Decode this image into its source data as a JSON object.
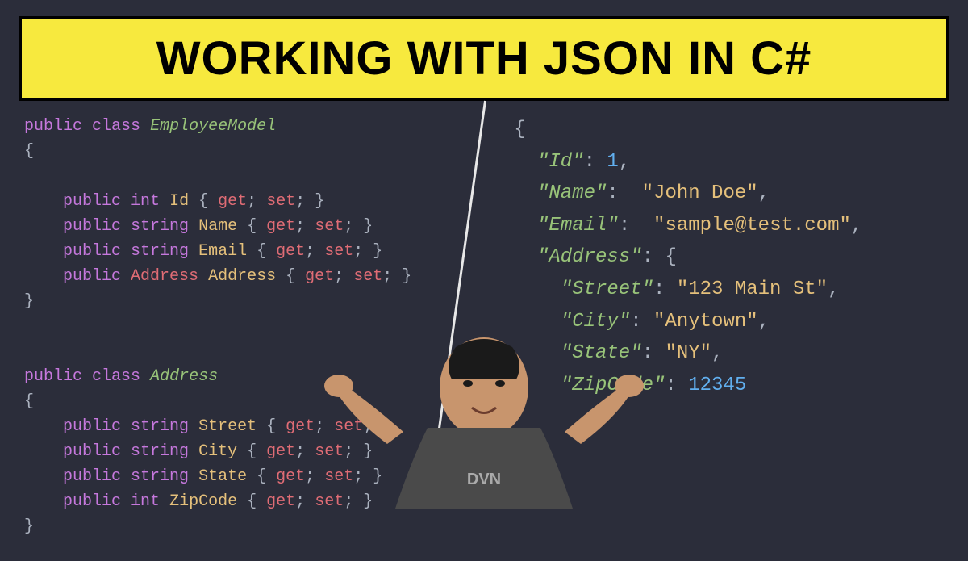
{
  "banner": "WORKING WITH JSON IN C#",
  "csharp": {
    "class1_name": "EmployeeModel",
    "class2_name": "Address",
    "kw_public": "public",
    "kw_class": "class",
    "kw_int": "int",
    "kw_string": "string",
    "kw_get": "get",
    "kw_set": "set",
    "type_Address": "Address",
    "props1": {
      "Id": "Id",
      "Name": "Name",
      "Email": "Email",
      "Address": "Address"
    },
    "props2": {
      "Street": "Street",
      "City": "City",
      "State": "State",
      "ZipCode": "ZipCode"
    },
    "brace_open": "{",
    "brace_close": "}",
    "semicolon": ";"
  },
  "json_data": {
    "keys": {
      "Id": "\"Id\"",
      "Name": "\"Name\"",
      "Email": "\"Email\"",
      "Address": "\"Address\"",
      "Street": "\"Street\"",
      "City": "\"City\"",
      "State": "\"State\"",
      "ZipCode": "\"ZipCode\""
    },
    "values": {
      "Id": "1",
      "Name": "\"John Doe\"",
      "Email": "\"sample@test.com\"",
      "Street": "\"123 Main St\"",
      "City": "\"Anytown\"",
      "State": "\"NY\"",
      "ZipCode": "12345"
    },
    "colon": ":",
    "comma": ",",
    "brace_open": "{",
    "brace_close": "}"
  }
}
